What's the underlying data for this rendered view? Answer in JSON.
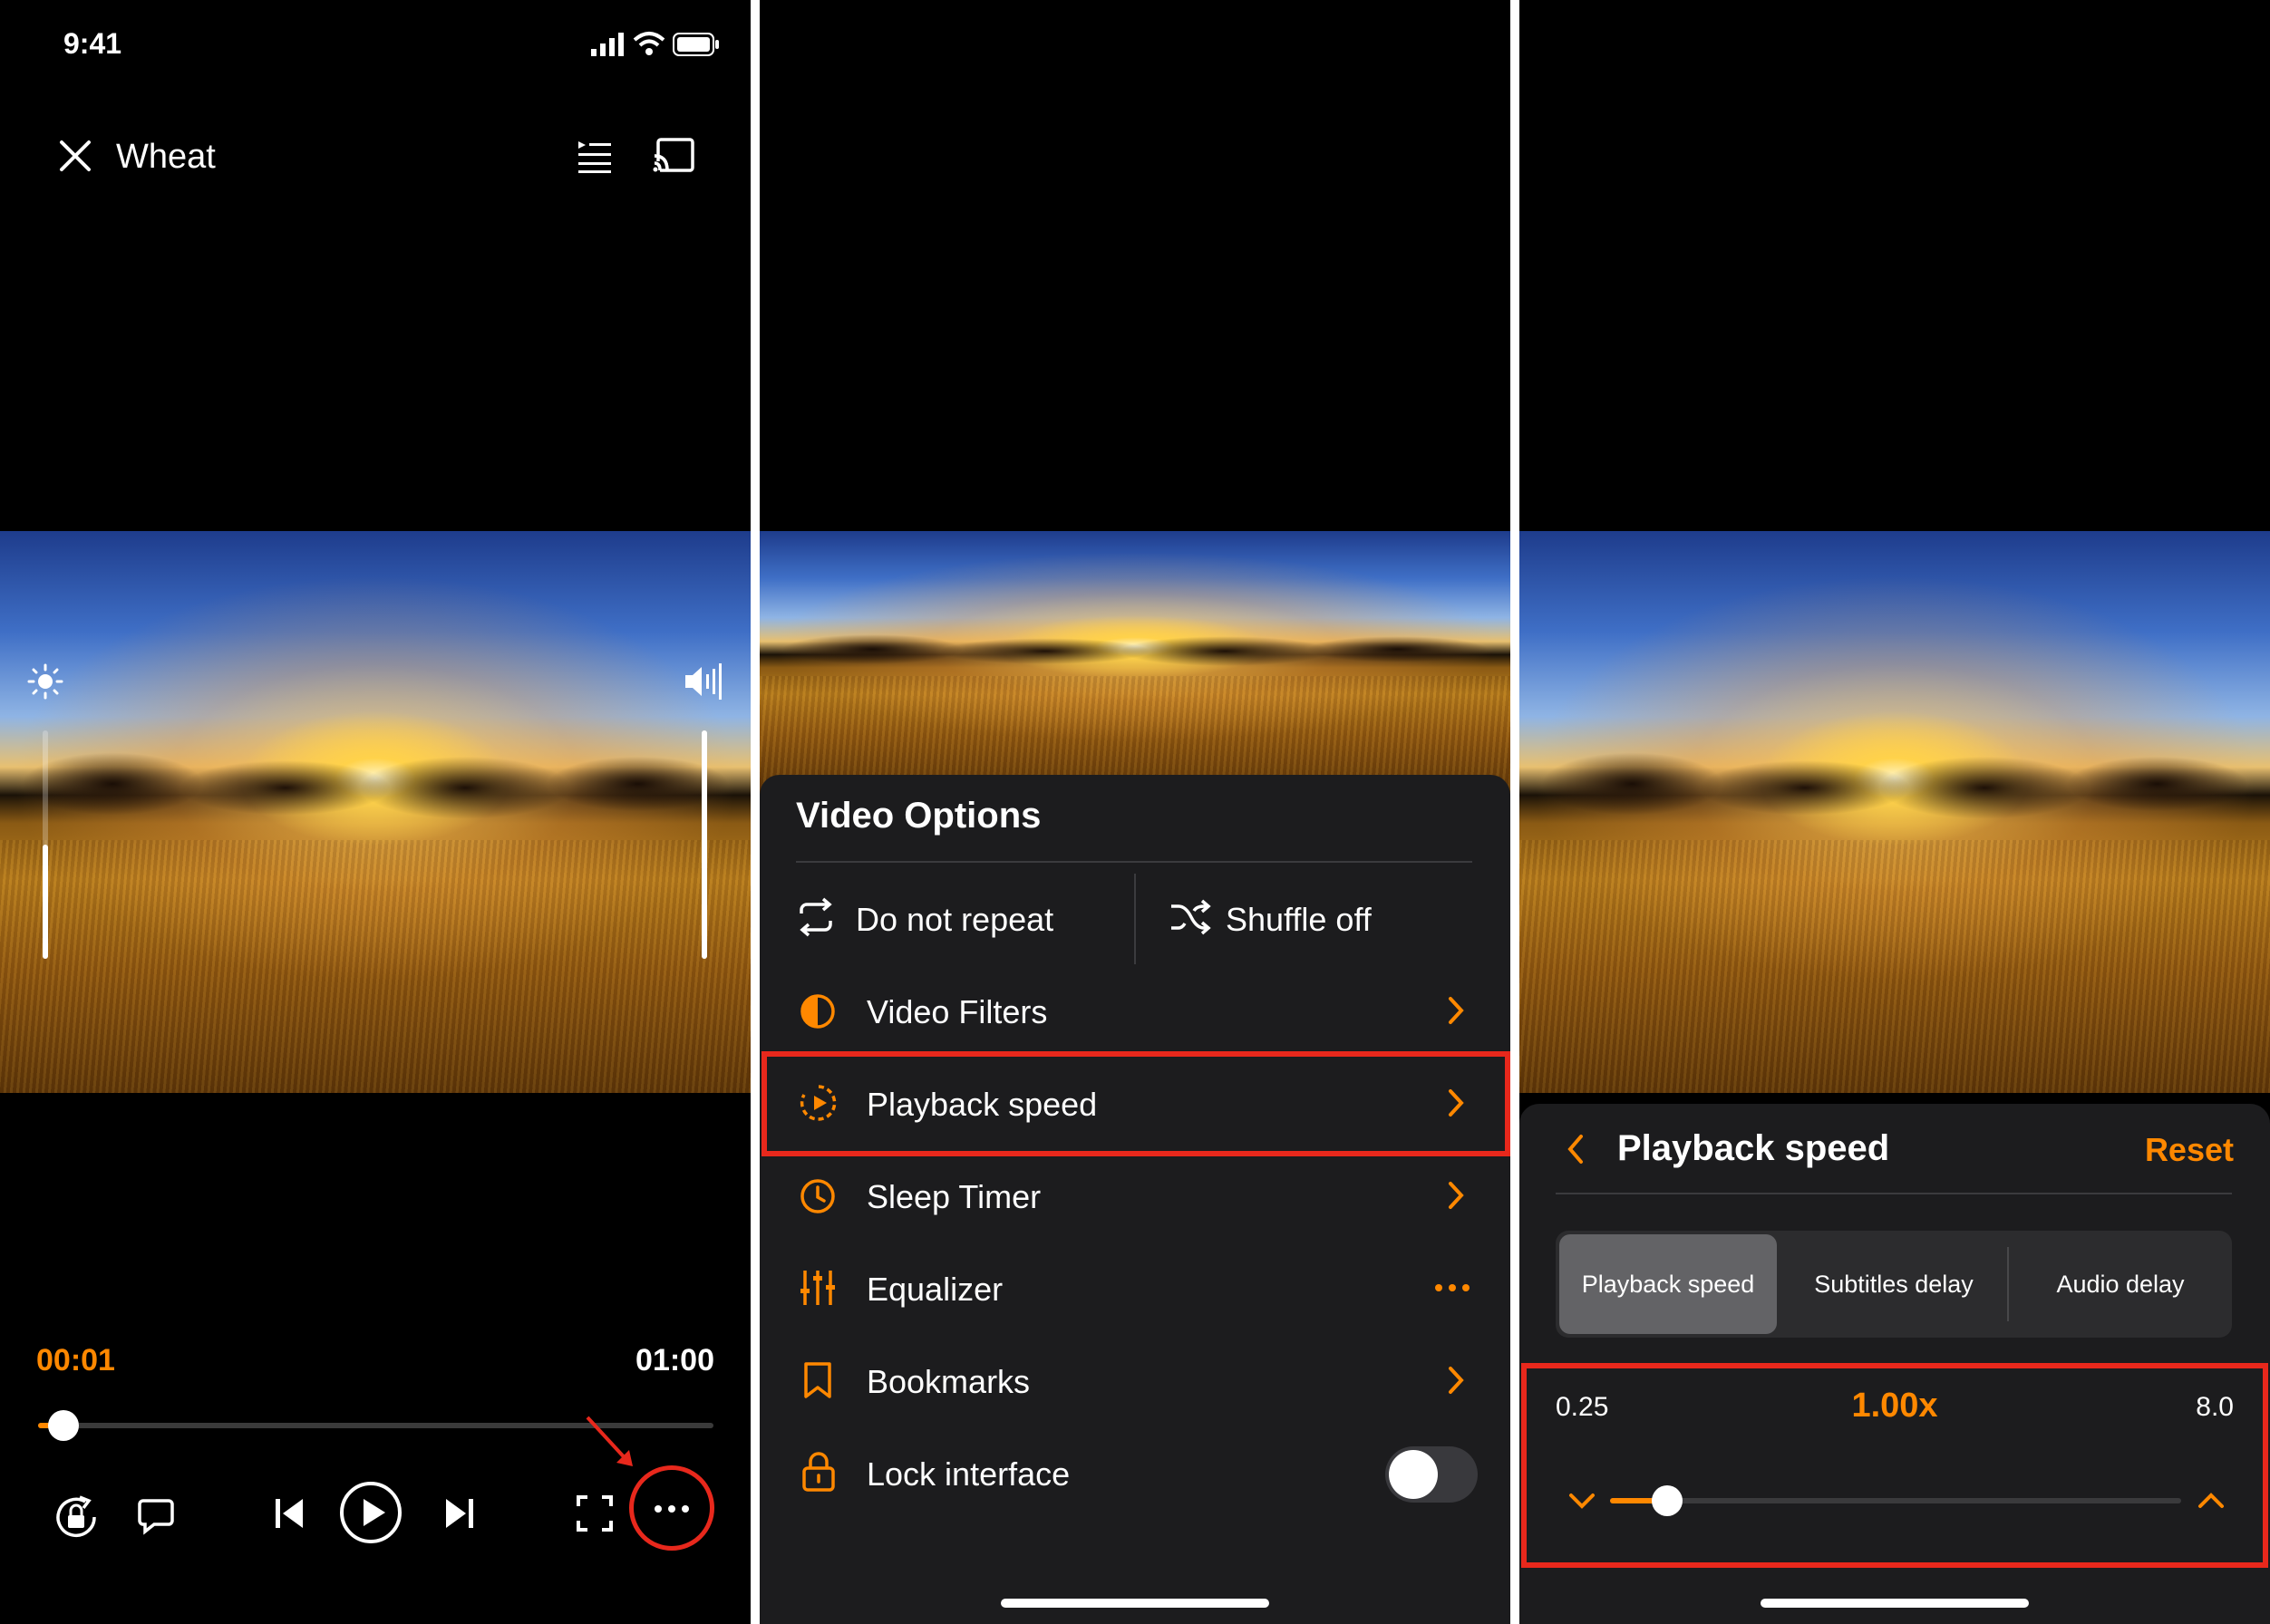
{
  "colors": {
    "accent": "#ff8800",
    "highlight": "#e8281c",
    "sheet": "#1c1c1e"
  },
  "player": {
    "status_time": "9:41",
    "title": "Wheat",
    "current_time": "00:01",
    "duration": "01:00",
    "progress_fraction": 0.017,
    "brightness_level": 0.5,
    "volume_level": 1.0,
    "icons": [
      "close-icon",
      "playlist-icon",
      "cast-icon",
      "brightness-icon",
      "volume-icon",
      "rotation-lock-icon",
      "subtitles-icon",
      "previous-icon",
      "play-icon",
      "next-icon",
      "fullscreen-icon",
      "more-icon"
    ]
  },
  "video_options": {
    "title": "Video Options",
    "repeat_label": "Do not repeat",
    "shuffle_label": "Shuffle off",
    "rows": [
      {
        "label": "Video Filters",
        "icon": "filters-icon",
        "trailing": "chevron"
      },
      {
        "label": "Playback speed",
        "icon": "playback-speed-icon",
        "trailing": "chevron",
        "highlighted": true
      },
      {
        "label": "Sleep Timer",
        "icon": "sleep-timer-icon",
        "trailing": "chevron"
      },
      {
        "label": "Equalizer",
        "icon": "equalizer-icon",
        "trailing": "more"
      },
      {
        "label": "Bookmarks",
        "icon": "bookmark-icon",
        "trailing": "chevron"
      },
      {
        "label": "Lock interface",
        "icon": "lock-icon",
        "trailing": "toggle",
        "toggle_on": false
      }
    ]
  },
  "playback_speed": {
    "title": "Playback speed",
    "reset_label": "Reset",
    "tabs": [
      "Playback speed",
      "Subtitles delay",
      "Audio delay"
    ],
    "active_tab": 0,
    "min_label": "0.25",
    "max_label": "8.0",
    "value_label": "1.00x",
    "slider_fraction": 0.1
  }
}
